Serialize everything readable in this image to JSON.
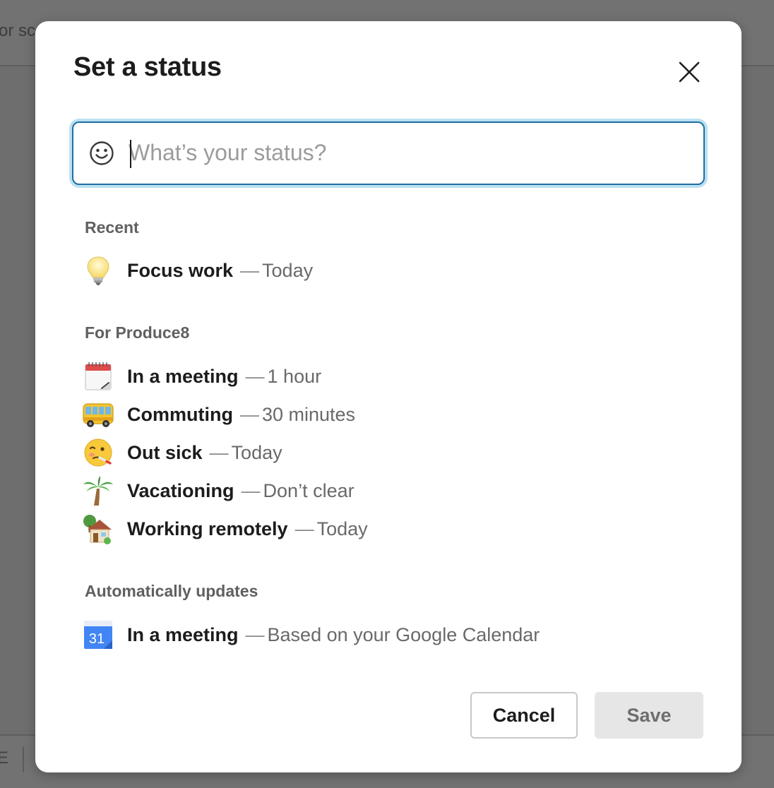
{
  "background": {
    "topbar_fragment": "or sc",
    "bottom_fragment": "E"
  },
  "modal": {
    "title": "Set a status",
    "close_label": "×"
  },
  "status_input": {
    "placeholder": "What’s your status?",
    "value": ""
  },
  "sections": {
    "recent": {
      "label": "Recent",
      "items": [
        {
          "icon": "lightbulb-icon",
          "name": "Focus work",
          "separator": "—",
          "duration": "Today"
        }
      ]
    },
    "workspace": {
      "label": "For Produce8",
      "items": [
        {
          "icon": "calendar-icon",
          "name": "In a meeting",
          "separator": "—",
          "duration": "1 hour"
        },
        {
          "icon": "bus-icon",
          "name": "Commuting",
          "separator": "—",
          "duration": "30 minutes"
        },
        {
          "icon": "sick-face-icon",
          "name": "Out sick",
          "separator": "—",
          "duration": "Today"
        },
        {
          "icon": "palm-tree-icon",
          "name": "Vacationing",
          "separator": "—",
          "duration": "Don’t clear"
        },
        {
          "icon": "house-icon",
          "name": "Working remotely",
          "separator": "—",
          "duration": "Today"
        }
      ]
    },
    "automatic": {
      "label": "Automatically updates",
      "items": [
        {
          "icon": "google-calendar-icon",
          "icon_text": "31",
          "name": "In a meeting",
          "separator": "—",
          "duration": "Based on your Google Calendar"
        }
      ]
    }
  },
  "buttons": {
    "cancel": "Cancel",
    "save": "Save"
  },
  "colors": {
    "focus_ring": "#1d9bd1",
    "google_calendar_blue": "#4285f4",
    "save_disabled_bg": "#e6e6e6"
  }
}
